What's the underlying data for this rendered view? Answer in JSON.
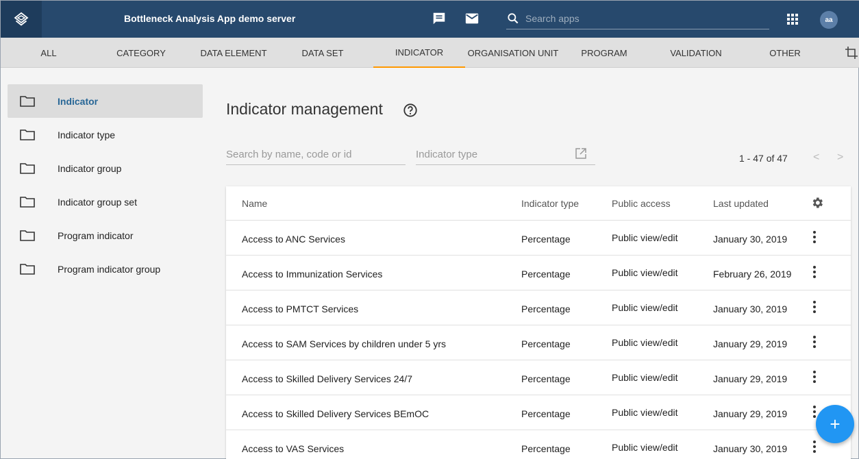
{
  "header": {
    "app_title": "Bottleneck Analysis App demo server",
    "search_placeholder": "Search apps",
    "avatar_initials": "aa",
    "bg_color": "#27496d"
  },
  "tabs": [
    {
      "label": "ALL"
    },
    {
      "label": "CATEGORY"
    },
    {
      "label": "DATA ELEMENT"
    },
    {
      "label": "DATA SET"
    },
    {
      "label": "INDICATOR",
      "active": true
    },
    {
      "label": "ORGANISATION UNIT"
    },
    {
      "label": "PROGRAM"
    },
    {
      "label": "VALIDATION"
    },
    {
      "label": "OTHER"
    }
  ],
  "sidebar": {
    "items": [
      {
        "label": "Indicator",
        "active": true
      },
      {
        "label": "Indicator type"
      },
      {
        "label": "Indicator group"
      },
      {
        "label": "Indicator group set"
      },
      {
        "label": "Program indicator"
      },
      {
        "label": "Program indicator group"
      }
    ]
  },
  "main": {
    "title": "Indicator management",
    "search_placeholder": "Search by name, code or id",
    "type_filter_placeholder": "Indicator type",
    "pager_text": "1 - 47 of 47",
    "prev_label": "<",
    "next_label": ">"
  },
  "table": {
    "headers": {
      "name": "Name",
      "type": "Indicator type",
      "access": "Public access",
      "updated": "Last updated"
    },
    "rows": [
      {
        "name": "Access to ANC Services",
        "type": "Percentage",
        "access": "Public view/edit",
        "updated": "January 30, 2019"
      },
      {
        "name": "Access to Immunization Services",
        "type": "Percentage",
        "access": "Public view/edit",
        "updated": "February 26, 2019"
      },
      {
        "name": "Access to PMTCT Services",
        "type": "Percentage",
        "access": "Public view/edit",
        "updated": "January 30, 2019"
      },
      {
        "name": "Access to SAM Services by children under 5 yrs",
        "type": "Percentage",
        "access": "Public view/edit",
        "updated": "January 29, 2019"
      },
      {
        "name": "Access to Skilled Delivery Services 24/7",
        "type": "Percentage",
        "access": "Public view/edit",
        "updated": "January 29, 2019"
      },
      {
        "name": "Access to Skilled Delivery Services BEmOC",
        "type": "Percentage",
        "access": "Public view/edit",
        "updated": "January 29, 2019"
      },
      {
        "name": "Access to VAS Services",
        "type": "Percentage",
        "access": "Public view/edit",
        "updated": "January 30, 2019"
      }
    ]
  },
  "fab": {
    "label": "+",
    "color": "#2196f3"
  },
  "accent_color": "#ff9800",
  "active_link_color": "#276696"
}
